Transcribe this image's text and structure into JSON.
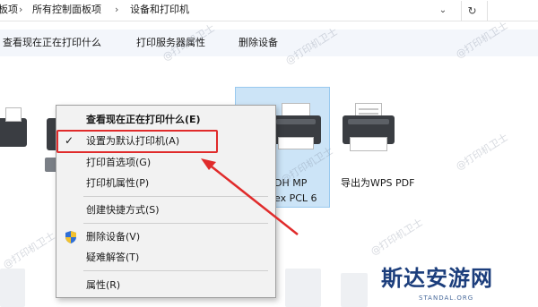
{
  "address_bar": {
    "crumbs": [
      "板项",
      "所有控制面板项",
      "设备和打印机"
    ],
    "separator": "›",
    "dropdown_icon": "chevron-down-icon",
    "refresh_icon": "refresh-icon"
  },
  "command_bar": {
    "items": [
      "查看现在正在打印什么",
      "打印服务器属性",
      "删除设备"
    ]
  },
  "devices": {
    "hp_label_1": "DH MP",
    "hp_label_2": "ex PCL 6",
    "wps_label": "导出为WPS PDF"
  },
  "context_menu": {
    "items": [
      {
        "label": "查看现在正在打印什么(E)",
        "bold": true
      },
      {
        "label": "设置为默认打印机(A)",
        "checked": true
      },
      {
        "label": "打印首选项(G)"
      },
      {
        "label": "打印机属性(P)"
      },
      {
        "label": "创建快捷方式(S)"
      },
      {
        "label": "删除设备(V)",
        "icon": "shield-icon"
      },
      {
        "label": "疑难解答(T)"
      },
      {
        "label": "属性(R)"
      }
    ]
  },
  "watermark": "@打印机卫士",
  "logo": {
    "title": "斯达安游网",
    "subtitle": "STANDAL.ORG"
  },
  "colors": {
    "highlight": "#e02b2b",
    "arrow": "#e02b2b",
    "selection": "#cce4f7",
    "logo": "#1c3e7c"
  }
}
